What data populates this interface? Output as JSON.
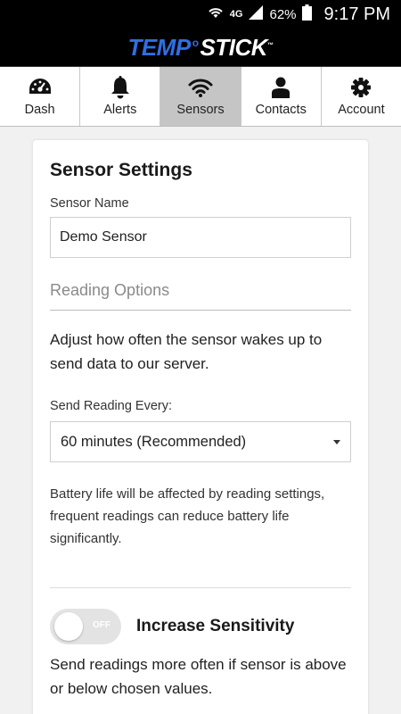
{
  "status_bar": {
    "network": "4G",
    "battery": "62%",
    "time": "9:17 PM",
    "icons": [
      "wifi-icon",
      "signal-icon",
      "battery-icon"
    ]
  },
  "brand": {
    "part1": "TEMP",
    "part2": "STICK",
    "trademark": "™",
    "colors": {
      "accent": "#2f6fe4",
      "bar": "#000000"
    }
  },
  "tabs": [
    {
      "label": "Dash",
      "icon": "dashboard-icon",
      "active": false
    },
    {
      "label": "Alerts",
      "icon": "bell-icon",
      "active": false
    },
    {
      "label": "Sensors",
      "icon": "wifi-icon",
      "active": true
    },
    {
      "label": "Contacts",
      "icon": "person-icon",
      "active": false
    },
    {
      "label": "Account",
      "icon": "gear-icon",
      "active": false
    }
  ],
  "settings": {
    "title": "Sensor Settings",
    "sensor_name_label": "Sensor Name",
    "sensor_name_value": "Demo Sensor",
    "reading_options_heading": "Reading Options",
    "reading_description": "Adjust how often the sensor wakes up to send data to our server.",
    "send_reading_label": "Send Reading Every:",
    "send_reading_value": "60 minutes (Recommended)",
    "battery_note": "Battery life will be affected by reading settings, frequent readings can reduce battery life significantly.",
    "sensitivity": {
      "toggle_state": "OFF",
      "title": "Increase Sensitivity",
      "description": "Send readings more often if sensor is above or below chosen values."
    }
  }
}
